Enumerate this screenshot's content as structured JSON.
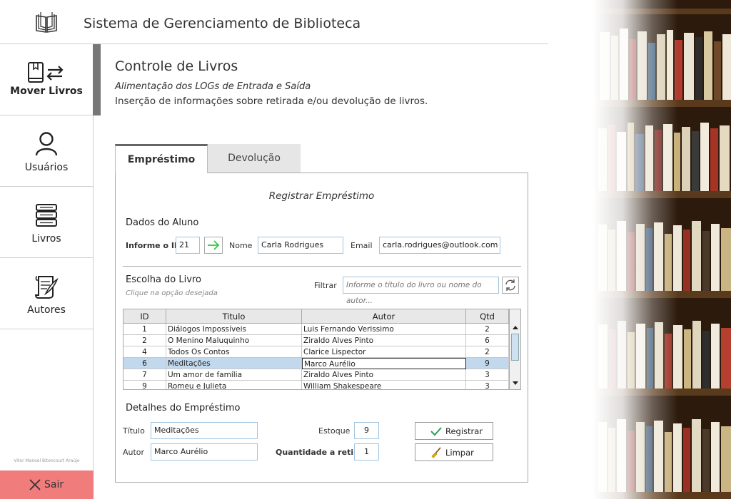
{
  "app": {
    "title": "Sistema de Gerenciamento de Biblioteca"
  },
  "sidebar": {
    "items": [
      {
        "label": "Mover Livros",
        "icon": "book-transfer-icon",
        "active": true
      },
      {
        "label": "Usuários",
        "icon": "user-icon",
        "active": false
      },
      {
        "label": "Livros",
        "icon": "books-stack-icon",
        "active": false
      },
      {
        "label": "Autores",
        "icon": "scroll-quill-icon",
        "active": false
      }
    ],
    "credit": "Vitor Manoel Bitencourt Araújo",
    "exit_label": "Sair"
  },
  "main": {
    "title": "Controle de Livros",
    "subtitle": "Alimentação dos LOGs de Entrada e Saída",
    "description": "Inserção de informações sobre retirada e/ou devolução de livros."
  },
  "tabs": [
    {
      "label": "Empréstimo",
      "active": true
    },
    {
      "label": "Devolução",
      "active": false
    }
  ],
  "form": {
    "heading": "Registrar Empréstimo",
    "student_section": "Dados do Aluno",
    "id_label": "Informe o ID",
    "id_value": "21",
    "name_label": "Nome",
    "name_value": "Carla Rodrigues",
    "email_label": "Email",
    "email_value": "carla.rodrigues@outlook.com",
    "book_section": "Escolha do Livro",
    "book_hint": "Clique na opção desejada",
    "filter_label": "Filtrar",
    "filter_placeholder": "Informe o título do livro ou nome do autor...",
    "table": {
      "headers": [
        "ID",
        "Titulo",
        "Autor",
        "Qtd"
      ],
      "rows": [
        {
          "id": "1",
          "title": "Diálogos Impossíveis",
          "author": "Luis Fernando Verissimo",
          "qtd": "2"
        },
        {
          "id": "2",
          "title": "O Menino Maluquinho",
          "author": "Ziraldo Alves Pinto",
          "qtd": "6"
        },
        {
          "id": "4",
          "title": "Todos Os Contos",
          "author": "Clarice Lispector",
          "qtd": "2"
        },
        {
          "id": "6",
          "title": "Meditações",
          "author": "Marco Aurélio",
          "qtd": "9",
          "selected": true
        },
        {
          "id": "7",
          "title": "Um amor de família",
          "author": "Ziraldo Alves Pinto",
          "qtd": "3"
        },
        {
          "id": "9",
          "title": "Romeu e Julieta",
          "author": "William Shakespeare",
          "qtd": "3"
        }
      ]
    },
    "details_section": "Detalhes do Empréstimo",
    "title_label": "Título",
    "title_value": "Meditações",
    "author_label": "Autor",
    "author_value": "Marco Aurélio",
    "stock_label": "Estoque",
    "stock_value": "9",
    "qty_label": "Quantidade a retirar",
    "qty_value": "1",
    "register_label": "Registrar",
    "clear_label": "Limpar"
  },
  "colors": {
    "exit_button": "#f07c7c",
    "selected_row": "#c2d8ec",
    "field_border": "#9ec4e0",
    "go_arrow": "#2ecc40"
  }
}
